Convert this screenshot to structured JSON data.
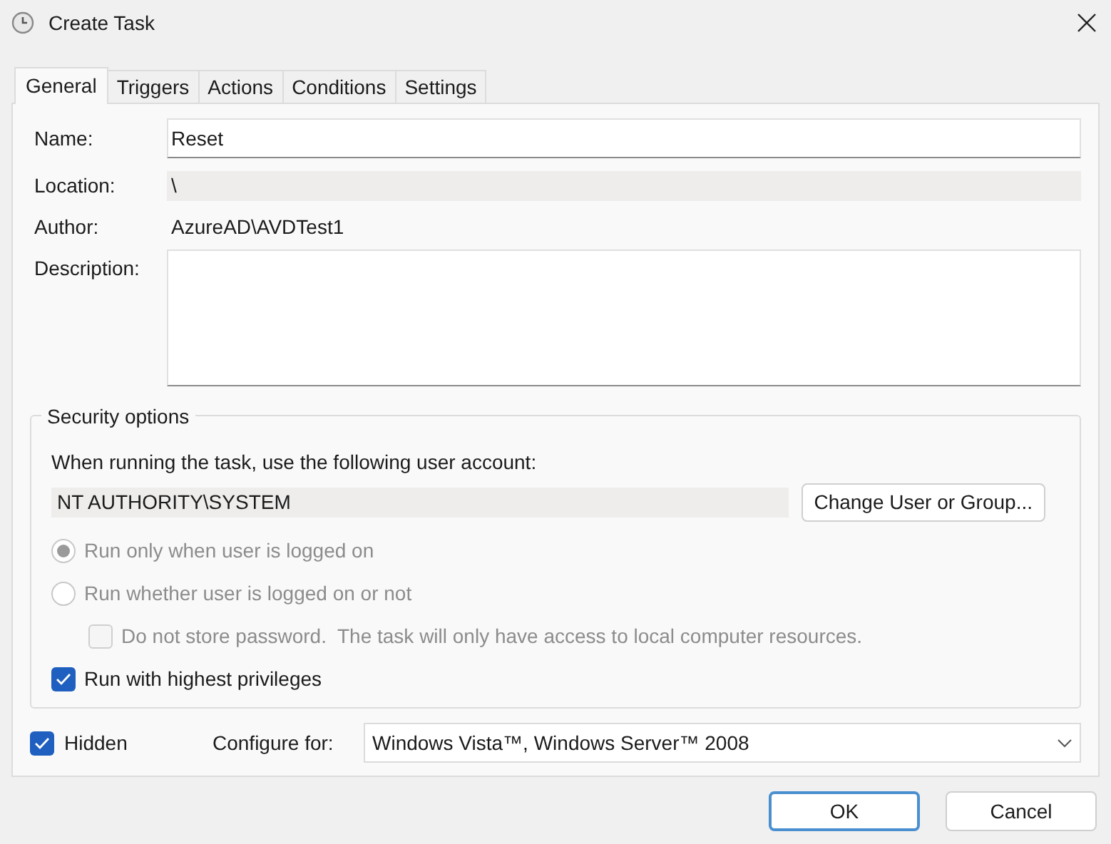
{
  "window": {
    "title": "Create Task"
  },
  "tabs": [
    {
      "label": "General",
      "selected": true
    },
    {
      "label": "Triggers",
      "selected": false
    },
    {
      "label": "Actions",
      "selected": false
    },
    {
      "label": "Conditions",
      "selected": false
    },
    {
      "label": "Settings",
      "selected": false
    }
  ],
  "general": {
    "name": {
      "label": "Name:",
      "value": "Reset"
    },
    "location": {
      "label": "Location:",
      "value": "\\"
    },
    "author": {
      "label": "Author:",
      "value": "AzureAD\\AVDTest1"
    },
    "description": {
      "label": "Description:"
    }
  },
  "security": {
    "legend": "Security options",
    "prompt": "When running the task, use the following user account:",
    "account": "NT AUTHORITY\\SYSTEM",
    "change_button": "Change User or Group...",
    "options": [
      {
        "kind": "radio",
        "label": "Run only when user is logged on",
        "selected": true,
        "disabled": true
      },
      {
        "kind": "radio",
        "label": "Run whether user is logged on or not",
        "selected": false,
        "disabled": true,
        "children": [
          {
            "kind": "checkbox",
            "label": "Do not store password.  The task will only have access to local computer resources.",
            "checked": false,
            "disabled": true
          }
        ]
      },
      {
        "kind": "checkbox",
        "label": "Run with highest privileges",
        "checked": true,
        "disabled": false
      }
    ]
  },
  "hidden": {
    "label": "Hidden",
    "checked": true
  },
  "configure_for": {
    "label": "Configure for:",
    "value": "Windows Vista™, Windows Server™ 2008"
  },
  "buttons": [
    {
      "label": "OK",
      "default": true
    },
    {
      "label": "Cancel",
      "default": false
    }
  ]
}
